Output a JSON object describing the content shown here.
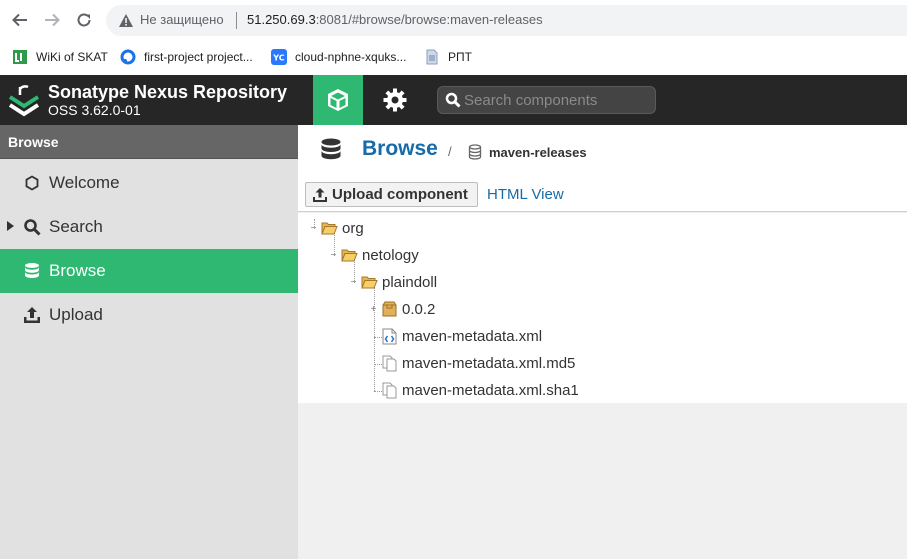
{
  "browser": {
    "insecure_label": "Не защищено",
    "url_host": "51.250.69.3",
    "url_rest": ":8081/#browse/browse:maven-releases"
  },
  "bookmarks": [
    {
      "label": "WiKi of SKAT",
      "icon": "wiki-icon"
    },
    {
      "label": "first-project project...",
      "icon": "cloud-project-icon"
    },
    {
      "label": "cloud-nphne-xquks...",
      "icon": "yc-icon"
    },
    {
      "label": "РПТ",
      "icon": "document-icon"
    }
  ],
  "header": {
    "title": "Sonatype Nexus Repository",
    "version": "OSS 3.62.0-01",
    "search_placeholder": "Search components"
  },
  "sidebar": {
    "heading": "Browse",
    "items": [
      {
        "label": "Welcome",
        "icon": "hexagon-icon"
      },
      {
        "label": "Search",
        "icon": "search-icon"
      },
      {
        "label": "Browse",
        "icon": "database-icon",
        "active": true
      },
      {
        "label": "Upload",
        "icon": "upload-icon"
      }
    ]
  },
  "breadcrumb": {
    "title": "Browse",
    "separator": "/",
    "repository": "maven-releases"
  },
  "toolbar": {
    "upload_label": "Upload component",
    "html_view_label": "HTML View"
  },
  "tree": [
    {
      "label": "org",
      "type": "folder",
      "expander": "−"
    },
    {
      "label": "netology",
      "type": "folder",
      "expander": "−"
    },
    {
      "label": "plaindoll",
      "type": "folder",
      "expander": "−"
    },
    {
      "label": "0.0.2",
      "type": "component",
      "expander": "+"
    },
    {
      "label": "maven-metadata.xml",
      "type": "xml"
    },
    {
      "label": "maven-metadata.xml.md5",
      "type": "file"
    },
    {
      "label": "maven-metadata.xml.sha1",
      "type": "file"
    }
  ]
}
